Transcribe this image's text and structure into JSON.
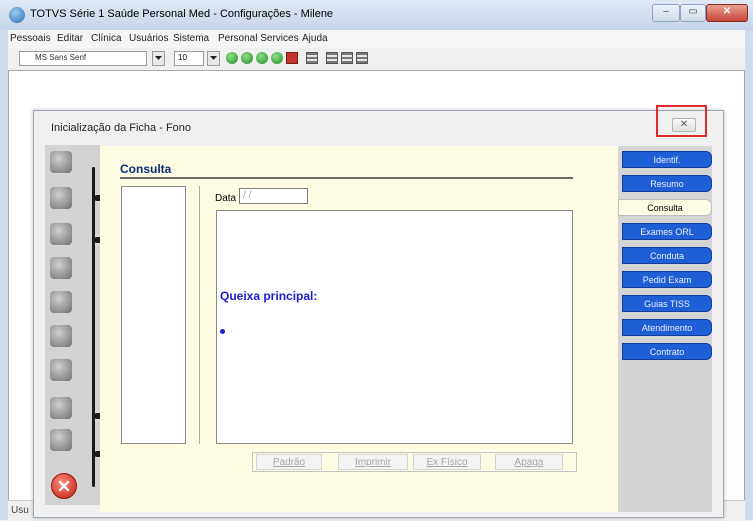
{
  "window": {
    "title": "TOTVS Série 1 Saúde Personal Med - Configurações - Milene",
    "controls": {
      "minimize": "–",
      "maximize": "▭",
      "close": "✕"
    }
  },
  "menu": [
    "Pessoais",
    "Editar",
    "Clínica",
    "Usuários",
    "Sistema",
    "Personal Services",
    "Ajuda"
  ],
  "toolbar": {
    "font_name": "MS Sans Serif",
    "font_size": "10"
  },
  "dialog": {
    "title": "Inicialização da Ficha - Fono",
    "close_label": "✕",
    "section_title": "Consulta",
    "date_label": "Data",
    "date_value": " / /",
    "complaint_label": "Queixa principal:",
    "buttons": [
      "Padrão",
      "Imprimir",
      "Ex Físico",
      "Apaga"
    ],
    "tabs": [
      {
        "label": "Identif.",
        "active": false
      },
      {
        "label": "Resumo",
        "active": false
      },
      {
        "label": "Consulta",
        "active": true
      },
      {
        "label": "Exames ORL",
        "active": false
      },
      {
        "label": "Conduta",
        "active": false
      },
      {
        "label": "Pedid Exam",
        "active": false
      },
      {
        "label": "Guias TISS",
        "active": false
      },
      {
        "label": "Atendimento",
        "active": false
      },
      {
        "label": "Contrato",
        "active": false
      }
    ]
  },
  "statusbar": {
    "text": "Usu"
  },
  "colors": {
    "tab_blue": "#1f5fd6",
    "page_bg": "#fdfbe1",
    "section_title": "#0b2a7a",
    "complaint_text": "#1d1dcf",
    "highlight": "#e12a2a"
  }
}
